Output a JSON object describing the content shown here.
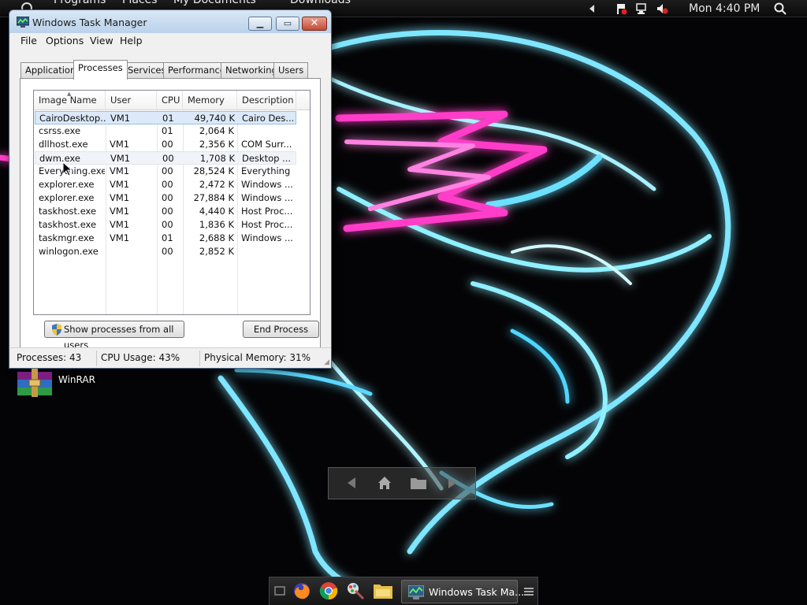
{
  "menubar": {
    "items": [
      "Programs",
      "Places",
      "My Documents",
      "Downloads"
    ],
    "clock": "Mon 4:40 PM",
    "icons": [
      "volume-arrow-icon",
      "flag-alert-icon",
      "network-icon",
      "speaker-muted-icon",
      "search-icon"
    ]
  },
  "window": {
    "title": "Windows Task Manager",
    "menu": [
      "File",
      "Options",
      "View",
      "Help"
    ],
    "tabs": [
      "Applications",
      "Processes",
      "Services",
      "Performance",
      "Networking",
      "Users"
    ],
    "active_tab": "Processes",
    "columns": [
      "Image Name",
      "User Name",
      "CPU",
      "Memory (...",
      "Description"
    ],
    "rows": [
      {
        "name": "CairoDesktop....",
        "user": "VM1",
        "cpu": "01",
        "mem": "49,740 K",
        "desc": "Cairo Des..."
      },
      {
        "name": "csrss.exe",
        "user": "",
        "cpu": "01",
        "mem": "2,064 K",
        "desc": ""
      },
      {
        "name": "dllhost.exe",
        "user": "VM1",
        "cpu": "00",
        "mem": "2,356 K",
        "desc": "COM Surr..."
      },
      {
        "name": "dwm.exe",
        "user": "VM1",
        "cpu": "00",
        "mem": "1,708 K",
        "desc": "Desktop ..."
      },
      {
        "name": "Everything.exe",
        "user": "VM1",
        "cpu": "00",
        "mem": "28,524 K",
        "desc": "Everything"
      },
      {
        "name": "explorer.exe",
        "user": "VM1",
        "cpu": "00",
        "mem": "2,472 K",
        "desc": "Windows ..."
      },
      {
        "name": "explorer.exe",
        "user": "VM1",
        "cpu": "00",
        "mem": "27,884 K",
        "desc": "Windows ..."
      },
      {
        "name": "taskhost.exe",
        "user": "VM1",
        "cpu": "00",
        "mem": "4,440 K",
        "desc": "Host Proc..."
      },
      {
        "name": "taskhost.exe",
        "user": "VM1",
        "cpu": "00",
        "mem": "1,836 K",
        "desc": "Host Proc..."
      },
      {
        "name": "taskmgr.exe",
        "user": "VM1",
        "cpu": "01",
        "mem": "2,688 K",
        "desc": "Windows ..."
      },
      {
        "name": "winlogon.exe",
        "user": "",
        "cpu": "00",
        "mem": "2,852 K",
        "desc": ""
      }
    ],
    "show_all_button": "Show processes from all users",
    "end_process_button": "End Process",
    "status": {
      "processes": "Processes: 43",
      "cpu": "CPU Usage: 43%",
      "memory": "Physical Memory: 31%"
    }
  },
  "desktop": {
    "icons": [
      {
        "label": "WinRAR",
        "icon": "winrar-icon"
      }
    ]
  },
  "navbar": {
    "icons": [
      "back-arrow-icon",
      "home-icon",
      "folder-icon",
      "forward-arrow-icon"
    ]
  },
  "taskbar": {
    "pinned": [
      "show-desktop-icon",
      "firefox-icon",
      "chrome-icon",
      "paint-icon",
      "file-manager-icon"
    ],
    "active_task": "Windows Task Ma...",
    "menu_icon": "hamburger-icon"
  },
  "colors": {
    "selection": "#dbe9f9",
    "title_gradient_top": "#d9e7f5",
    "close_button": "#c44a32"
  }
}
